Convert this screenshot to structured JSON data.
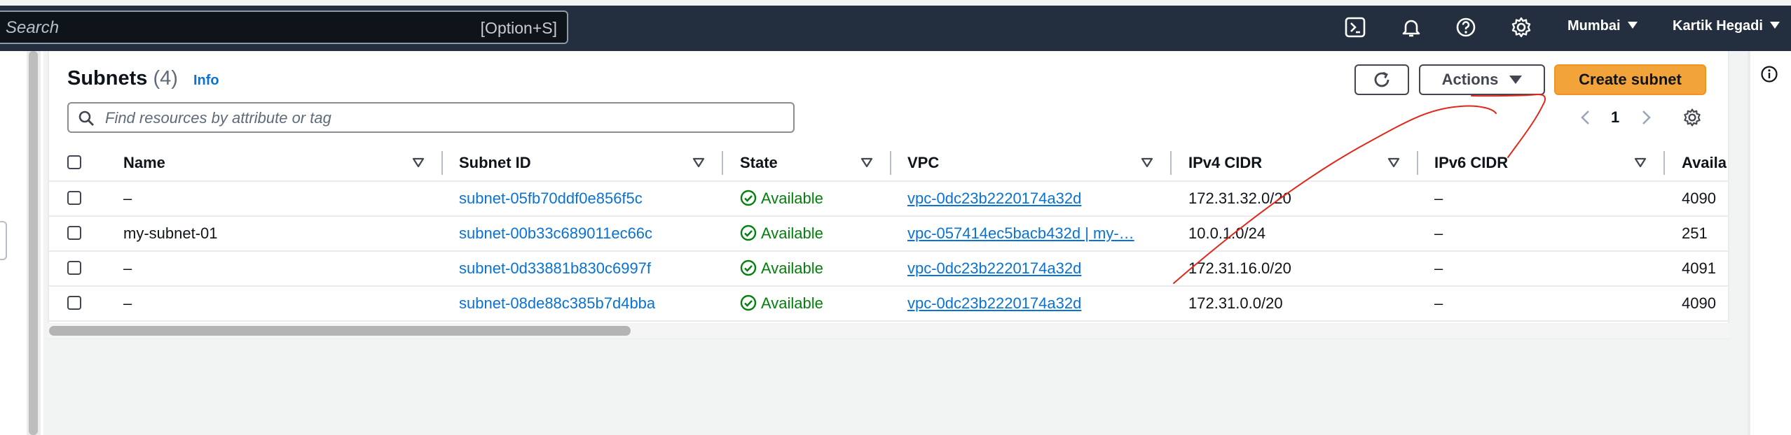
{
  "topnav": {
    "search_placeholder": "Search",
    "search_shortcut": "[Option+S]",
    "region": "Mumbai",
    "user": "Kartik Hegadi"
  },
  "panel": {
    "title": "Subnets",
    "count": "(4)",
    "info": "Info",
    "actions_label": "Actions",
    "create_label": "Create subnet",
    "filter_placeholder": "Find resources by attribute or tag",
    "page": "1"
  },
  "table": {
    "headers": {
      "name": "Name",
      "subnet_id": "Subnet ID",
      "state": "State",
      "vpc": "VPC",
      "ipv4": "IPv4 CIDR",
      "ipv6": "IPv6 CIDR",
      "avail": "Availa"
    },
    "rows": [
      {
        "name": "–",
        "subnet_id": "subnet-05fb70ddf0e856f5c",
        "state": "Available",
        "vpc": "vpc-0dc23b2220174a32d",
        "ipv4": "172.31.32.0/20",
        "ipv6": "–",
        "avail": "4090"
      },
      {
        "name": "my-subnet-01",
        "subnet_id": "subnet-00b33c689011ec66c",
        "state": "Available",
        "vpc": "vpc-057414ec5bacb432d | my-…",
        "ipv4": "10.0.1.0/24",
        "ipv6": "–",
        "avail": "251"
      },
      {
        "name": "–",
        "subnet_id": "subnet-0d33881b830c6997f",
        "state": "Available",
        "vpc": "vpc-0dc23b2220174a32d",
        "ipv4": "172.31.16.0/20",
        "ipv6": "–",
        "avail": "4091"
      },
      {
        "name": "–",
        "subnet_id": "subnet-08de88c385b7d4bba",
        "state": "Available",
        "vpc": "vpc-0dc23b2220174a32d",
        "ipv4": "172.31.0.0/20",
        "ipv6": "–",
        "avail": "4090"
      }
    ]
  },
  "icons": {
    "cloudshell": "terminal-icon",
    "notifications": "bell-icon",
    "help": "help-icon",
    "settings": "gear-icon",
    "refresh": "refresh-icon",
    "search": "search-icon",
    "info_panel": "info-icon"
  },
  "colors": {
    "nav_bg": "#232f3e",
    "primary_button": "#f2a43a",
    "link": "#0972d3",
    "available": "#037f0c",
    "annotation": "#e0271a"
  }
}
